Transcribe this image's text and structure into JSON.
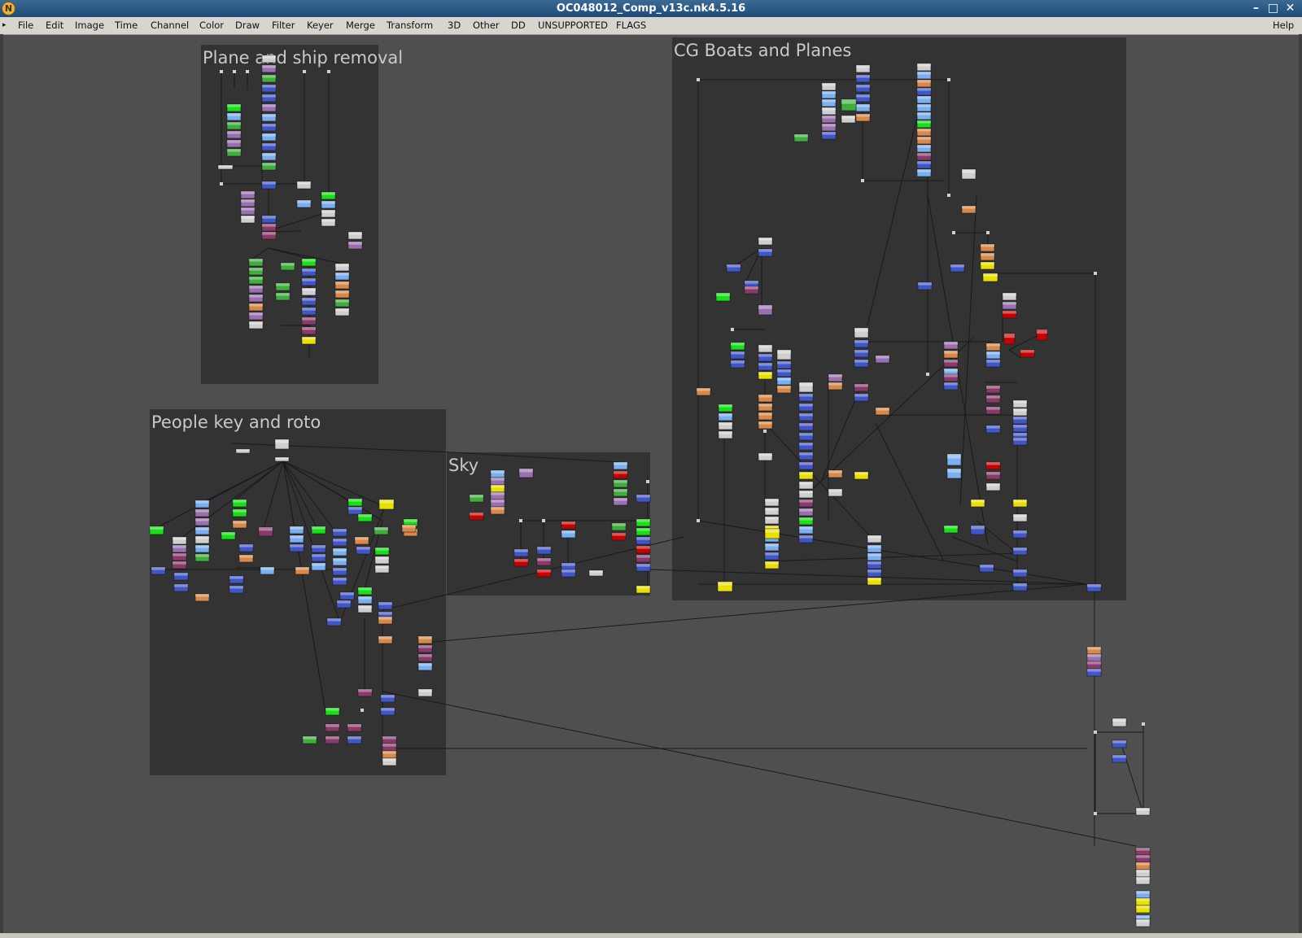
{
  "window": {
    "title": "OC048012_Comp_v13c.nk4.5.16",
    "app_icon": "nuke-icon",
    "icon_glyph": "N",
    "controls": [
      "minimize-icon",
      "maximize-icon",
      "close-icon"
    ],
    "minimize_glyph": "–",
    "maximize_glyph": "□",
    "close_glyph": "✕"
  },
  "menu": {
    "items": [
      "File",
      "Edit",
      "Image",
      "Time",
      "Channel",
      "Color",
      "Draw",
      "Filter",
      "Keyer",
      "Merge",
      "Transform",
      "3D",
      "Other",
      "DD",
      "UNSUPPORTED",
      "FLAGS"
    ],
    "help": "Help"
  },
  "node_graph": {
    "background_color": "#4f4f4f",
    "backdrops": [
      {
        "label": "Plane and ship removal"
      },
      {
        "label": "People key and roto"
      },
      {
        "label": "Sky"
      },
      {
        "label": "CG Boats and Planes"
      }
    ],
    "colors": {
      "backdrop": "#333333",
      "backdrop_label": "#c9c9c9",
      "wire": "#1a1a1a",
      "read": "#cfcfcf",
      "transform": "#4156c8",
      "grade": "#7ab0f0",
      "merge": "#8a3a6a",
      "roto": "#3fae3f",
      "keyer": "#16e016",
      "color": "#d88848",
      "filter": "#9a70b0",
      "write": "#e8e000",
      "red": "#c80000",
      "dot": "#d0d0d0"
    }
  }
}
